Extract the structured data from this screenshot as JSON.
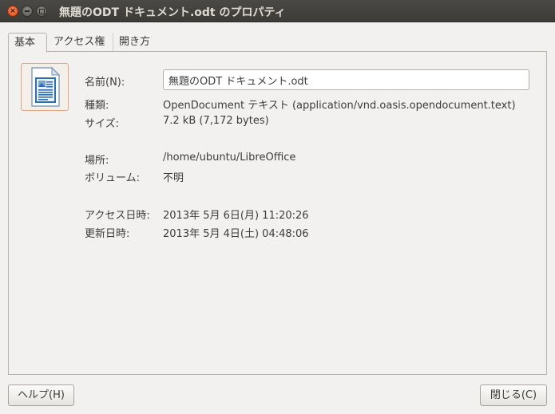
{
  "window": {
    "title": "無題のODT ドキュメント.odt のプロパティ"
  },
  "tabs": [
    {
      "label": "基本",
      "active": true
    },
    {
      "label": "アクセス権",
      "active": false
    },
    {
      "label": "開き方",
      "active": false
    }
  ],
  "file": {
    "icon": "libreoffice-writer-document-icon",
    "name_label": "名前(N):",
    "name_value": "無題のODT ドキュメント.odt",
    "type_label": "種類:",
    "type_value": "OpenDocument テキスト (application/vnd.oasis.opendocument.text)",
    "size_label": "サイズ:",
    "size_value": "7.2 kB (7,172 bytes)",
    "location_label": "場所:",
    "location_value": "/home/ubuntu/LibreOffice",
    "volume_label": "ボリューム:",
    "volume_value": "不明",
    "accessed_label": "アクセス日時:",
    "accessed_value": "2013年 5月 6日(月) 11:20:26",
    "modified_label": "更新日時:",
    "modified_value": "2013年 5月 4日(土) 04:48:06"
  },
  "buttons": {
    "help": "ヘルプ(H)",
    "close": "閉じる(C)"
  },
  "colors": {
    "titlebar": "#3c3b37",
    "close_button": "#dd4814",
    "background": "#f2f1f0"
  }
}
